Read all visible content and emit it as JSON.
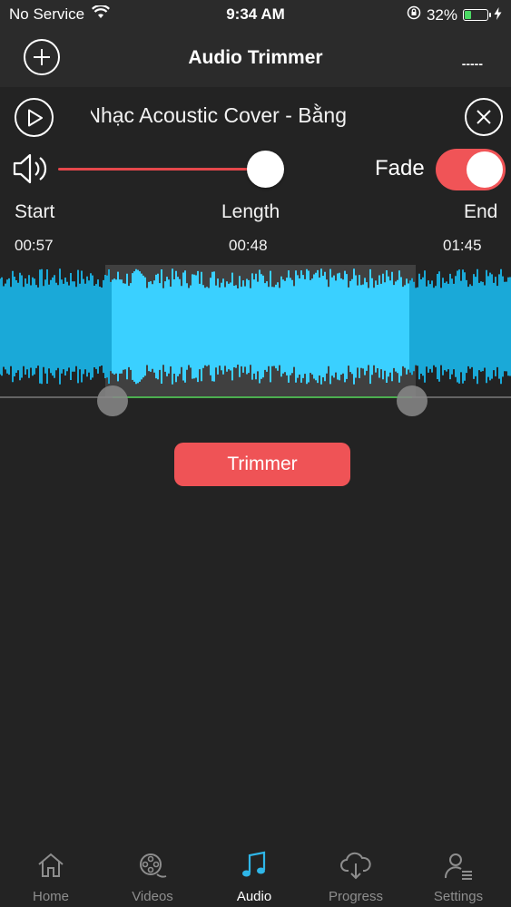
{
  "status_bar": {
    "carrier": "No Service",
    "time": "9:34 AM",
    "battery_percent": "32%",
    "battery_level": 0.32,
    "battery_color": "#4cd964"
  },
  "nav": {
    "title": "Audio Trimmer",
    "menu_label": "-----",
    "add_icon": "plus-circle-icon"
  },
  "player": {
    "track_title": "Nhạc Acoustic Cover - Bằng",
    "play_icon": "play-circle-icon",
    "close_icon": "close-circle-icon"
  },
  "volume": {
    "level": 1.0,
    "icon": "speaker-icon",
    "accent_color": "#e5474b"
  },
  "fade": {
    "label": "Fade",
    "enabled": true,
    "color": "#f05457"
  },
  "trim_info": {
    "start_label": "Start",
    "length_label": "Length",
    "end_label": "End",
    "start_value": "00:57",
    "length_value": "00:48",
    "end_value": "01:45"
  },
  "waveform": {
    "selection_start_fraction": 0.22,
    "selection_end_fraction": 0.8,
    "wave_color": "#1aa9d8",
    "selected_color": "#3ad0ff"
  },
  "action": {
    "trim_label": "Trimmer",
    "color": "#ef5356"
  },
  "tabs": [
    {
      "label": "Home",
      "icon": "home-icon",
      "active": false
    },
    {
      "label": "Videos",
      "icon": "film-reel-icon",
      "active": false
    },
    {
      "label": "Audio",
      "icon": "music-note-icon",
      "active": true
    },
    {
      "label": "Progress",
      "icon": "cloud-download-icon",
      "active": false
    },
    {
      "label": "Settings",
      "icon": "user-settings-icon",
      "active": false
    }
  ]
}
